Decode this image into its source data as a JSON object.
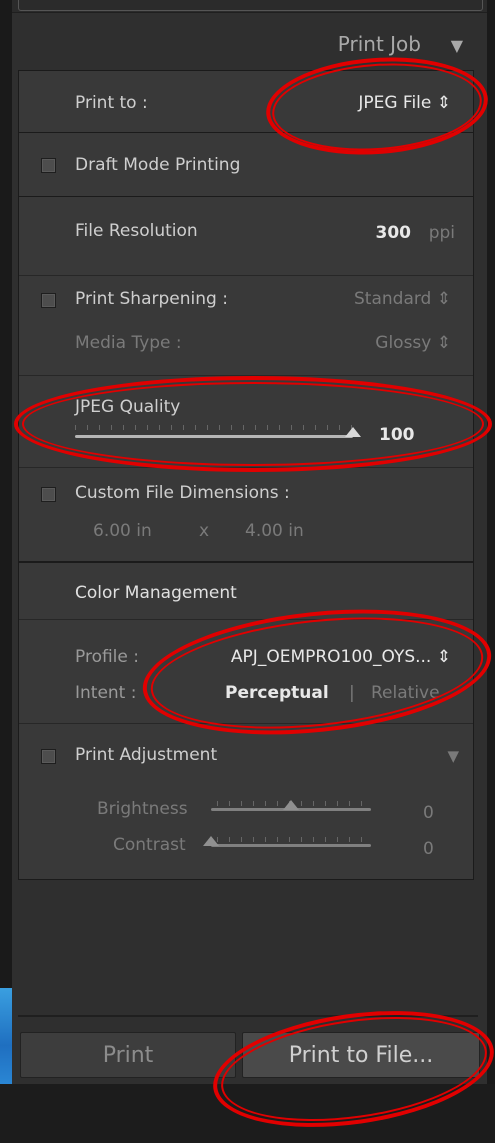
{
  "header": {
    "title": "Print Job",
    "collapse_icon": "triangle-down-icon"
  },
  "print_to": {
    "label": "Print to :",
    "value": "JPEG File",
    "arrows": "⬍"
  },
  "draft": {
    "label": "Draft Mode Printing"
  },
  "file_resolution": {
    "label": "File Resolution",
    "value": "300",
    "unit": "ppi"
  },
  "sharpening": {
    "label": "Print Sharpening :",
    "value": "Standard",
    "arrows": "⬍"
  },
  "media_type": {
    "label": "Media Type :",
    "value": "Glossy",
    "arrows": "⬍"
  },
  "jpeg_quality": {
    "label": "JPEG Quality",
    "value": "100",
    "level": 1.0
  },
  "custom_dims": {
    "label": "Custom File Dimensions :",
    "width": "6.00 in",
    "x": "x",
    "height": "4.00 in"
  },
  "color_mgmt": {
    "title": "Color Management"
  },
  "profile": {
    "label": "Profile :",
    "value": "APJ_OEMPRO100_OYS...",
    "arrows": "⬍"
  },
  "intent": {
    "label": "Intent :",
    "option_active": "Perceptual",
    "divider": "|",
    "option_other": "Relative"
  },
  "print_adjustment": {
    "label": "Print Adjustment",
    "collapse_icon": "triangle-down-icon"
  },
  "brightness": {
    "label": "Brightness",
    "value": "0",
    "level": 0.5
  },
  "contrast": {
    "label": "Contrast",
    "value": "0",
    "level": 0.0
  },
  "buttons": {
    "print": "Print",
    "print_to_file": "Print to File..."
  },
  "colors": {
    "annotation": "#e10000",
    "panel": "#393939"
  }
}
